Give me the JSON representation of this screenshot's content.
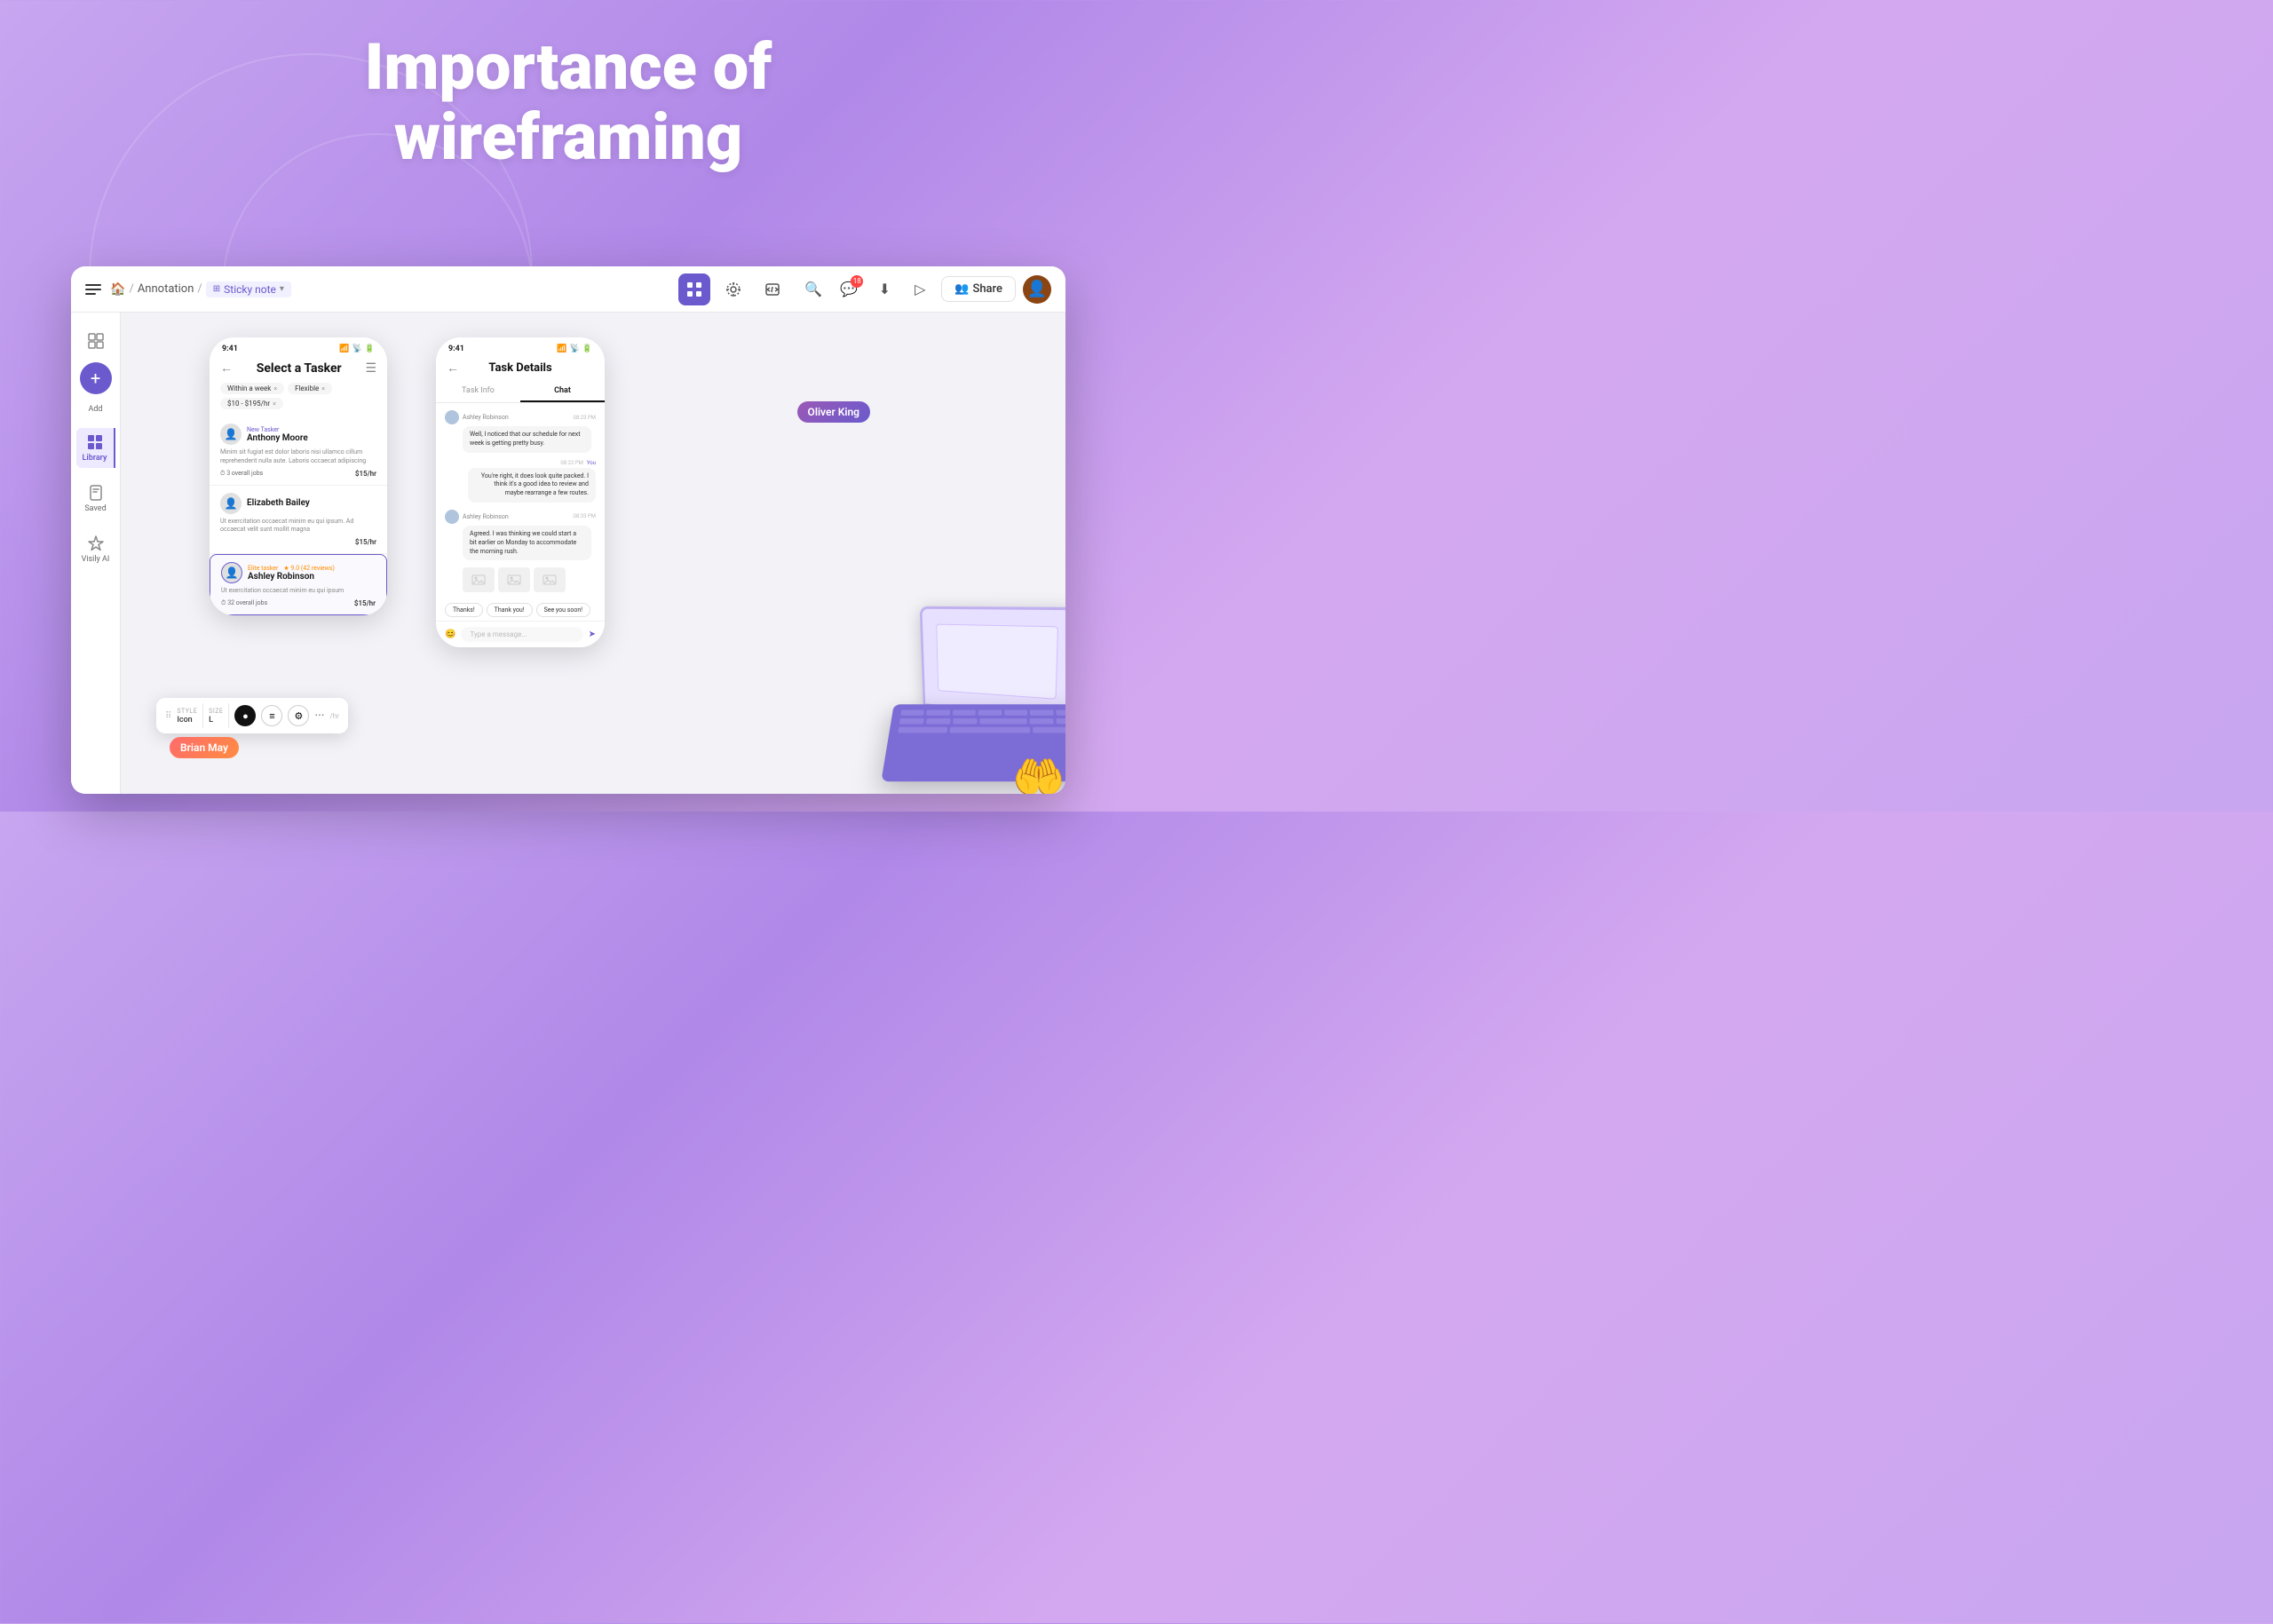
{
  "hero": {
    "line1": "Importance of",
    "line2": "wireframing"
  },
  "toolbar": {
    "breadcrumb": {
      "home": "🏠",
      "annotation": "Annotation",
      "sep1": "/",
      "sep2": "/",
      "sticky_note": "Sticky note"
    },
    "center_icons": [
      {
        "name": "frame-icon",
        "label": "Frame",
        "active": true
      },
      {
        "name": "lightning-icon",
        "label": "Plugin"
      },
      {
        "name": "code-icon",
        "label": "Code"
      }
    ],
    "right": {
      "notification_count": "18",
      "share_label": "Share"
    }
  },
  "sidebar": {
    "items": [
      {
        "name": "shapes-item",
        "label": ""
      },
      {
        "name": "add-item",
        "label": "Add"
      },
      {
        "name": "library-item",
        "label": "Library",
        "active": true
      },
      {
        "name": "saved-item",
        "label": "Saved"
      },
      {
        "name": "ai-item",
        "label": "Visily AI"
      }
    ]
  },
  "phone1": {
    "status_time": "9:41",
    "title": "Select a Tasker",
    "filters": [
      "Within a week ×",
      "Flexible ×",
      "$10 - $195/hr ×"
    ],
    "taskers": [
      {
        "name": "Anthony Moore",
        "badge": "New Tasker",
        "desc": "Minim sit fugiat est dolor laboris nisi ullamco cillum reprehenderit nulla aute. Laboris occaecat adipiscing",
        "jobs": "3 overall jobs",
        "rate": "$15/hr",
        "featured": false
      },
      {
        "name": "Elizabeth Bailey",
        "badge": "",
        "desc": "Ut exercitation occaecat minim eu qui ipsum. Ad occaecat velit sunt mollit magna",
        "jobs": "",
        "rate": "$15/hr",
        "featured": false
      },
      {
        "name": "Ashley Robinson",
        "badge": "Elite tasker",
        "rating": "★ 9.0 (42 reviews)",
        "desc": "Ut exercitation occaecat minim eu qui ipsum",
        "jobs": "32 overall jobs",
        "rate": "$15/hr",
        "featured": true
      }
    ],
    "style_toolbar": {
      "style_label": "STYLE",
      "style_value": "Icon",
      "size_label": "SIZE",
      "size_value": "L"
    }
  },
  "phone2": {
    "status_time": "9:41",
    "title": "Task Details",
    "tabs": [
      "Task Info",
      "Chat"
    ],
    "active_tab": "Chat",
    "messages": [
      {
        "sender": "Ashley Robinson",
        "time": "08:23 PM",
        "text": "Well, I noticed that our schedule for next week is getting pretty busy.",
        "side": "left"
      },
      {
        "sender": "You",
        "time": "08:22 PM",
        "text": "You're right, it does look quite packed. I think it's a good idea to review and maybe rearrange a few routes.",
        "side": "right"
      },
      {
        "sender": "Ashley Robinson",
        "time": "08:33 PM",
        "text": "Agreed. I was thinking we could start a bit earlier on Monday to accommodate the morning rush.",
        "side": "left"
      }
    ],
    "quick_replies": [
      "Thanks!",
      "Thank you!",
      "See you soon!"
    ],
    "input_placeholder": "Type a message...",
    "has_images": true
  },
  "annotations": {
    "brian": "Brian May",
    "oliver": "Oliver King"
  }
}
